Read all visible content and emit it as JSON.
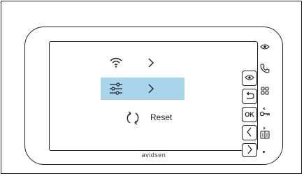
{
  "device": {
    "brand": "avidsen"
  },
  "menu": {
    "items": [
      {
        "icon": "wifi-icon",
        "label": "",
        "selected": false
      },
      {
        "icon": "settings-sliders-icon",
        "label": "",
        "selected": true
      },
      {
        "icon": "reset-icon",
        "label": "Reset",
        "selected": false
      }
    ],
    "selected_color": "#a8d4ec"
  },
  "screen_buttons": [
    {
      "icon": "eye-icon",
      "label": ""
    },
    {
      "icon": "back-icon",
      "label": ""
    },
    {
      "icon": "ok-icon",
      "label": "OK"
    },
    {
      "icon": "left-arrow-icon",
      "label": ""
    },
    {
      "icon": "right-arrow-icon",
      "label": ""
    }
  ],
  "side_icons": [
    {
      "icon": "eye-icon"
    },
    {
      "icon": "phone-icon"
    },
    {
      "icon": "grid-icon"
    },
    {
      "icon": "key-previous-icon"
    },
    {
      "icon": "gate-next-icon"
    }
  ]
}
